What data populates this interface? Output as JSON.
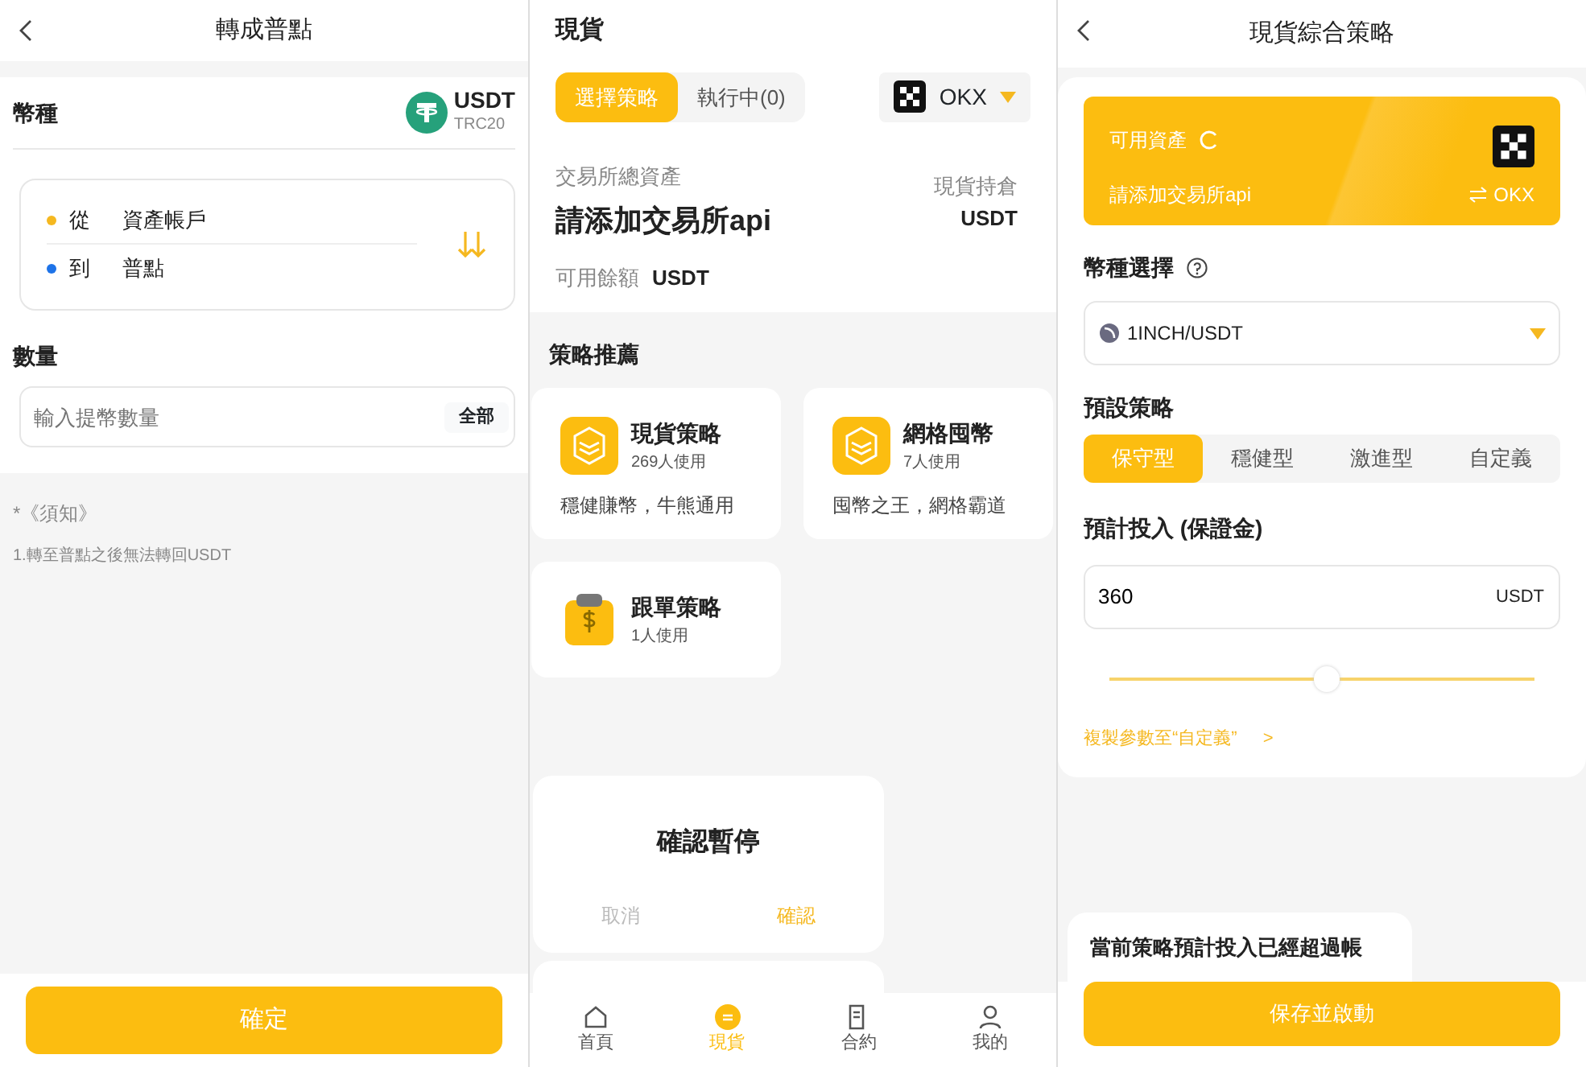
{
  "transfer_screen": {
    "title": "轉成普點",
    "currency": {
      "label": "幣種",
      "coin": "USDT",
      "network": "TRC20"
    },
    "transfer": {
      "from_label": "從",
      "from_value": "資產帳戶",
      "to_label": "到",
      "to_value": "普點"
    },
    "amount": {
      "label": "數量",
      "placeholder": "輸入提幣數量",
      "all_button": "全部"
    },
    "notes": [
      "*《須知》",
      "1.轉至普點之後無法轉回USDT"
    ],
    "confirm_button": "確定"
  },
  "spot_screen": {
    "title": "現貨",
    "tabs": [
      {
        "label": "選擇策略",
        "selected": true
      },
      {
        "label": "執行中(0)",
        "selected": false
      }
    ],
    "exchange": "OKX",
    "total_assets_label": "交易所總資產",
    "total_assets_value": "請添加交易所api",
    "holdings_label": "現貨持倉",
    "holdings_value": "USDT",
    "balance_label": "可用餘額",
    "balance_value": "USDT",
    "section_title": "策略推薦",
    "strategies": [
      {
        "kind": "stack",
        "name": "現貨策略",
        "users": "269人使用",
        "description": "穩健賺幣，牛熊通用"
      },
      {
        "kind": "stack",
        "name": "網格囤幣",
        "users": "7人使用",
        "description": "囤幣之王，網格霸道"
      },
      {
        "kind": "clipboard",
        "name": "跟單策略",
        "users": "1人使用"
      }
    ],
    "dialog": {
      "title": "確認暫停",
      "buttons": [
        {
          "kind": "cancel",
          "label": "取消"
        },
        {
          "kind": "confirm",
          "label": "確認"
        }
      ]
    },
    "nav": [
      {
        "kind": "home",
        "label": "首頁",
        "selected": false
      },
      {
        "kind": "spot",
        "label": "現貨",
        "selected": true
      },
      {
        "kind": "contract",
        "label": "合約",
        "selected": false
      },
      {
        "kind": "profile",
        "label": "我的",
        "selected": false
      }
    ]
  },
  "strategy_screen": {
    "title": "現貨綜合策略",
    "banner": {
      "label": "可用資產",
      "value": "請添加交易所api",
      "exchange": "OKX"
    },
    "coin_label": "幣種選擇",
    "pair": "1INCH/USDT",
    "preset_label": "預設策略",
    "presets": [
      {
        "label": "保守型",
        "selected": true
      },
      {
        "label": "穩健型",
        "selected": false
      },
      {
        "label": "激進型",
        "selected": false
      },
      {
        "label": "自定義",
        "selected": false
      }
    ],
    "invest_label": "預計投入 (保證金)",
    "invest_value": "360",
    "invest_unit": "USDT",
    "slider": {
      "level": 0.51
    },
    "copy_link": "複製參數至“自定義”",
    "copy_link_arrow": ">",
    "warning": "當前策略預計投入已經超過帳",
    "save_button": "保存並啟動"
  }
}
